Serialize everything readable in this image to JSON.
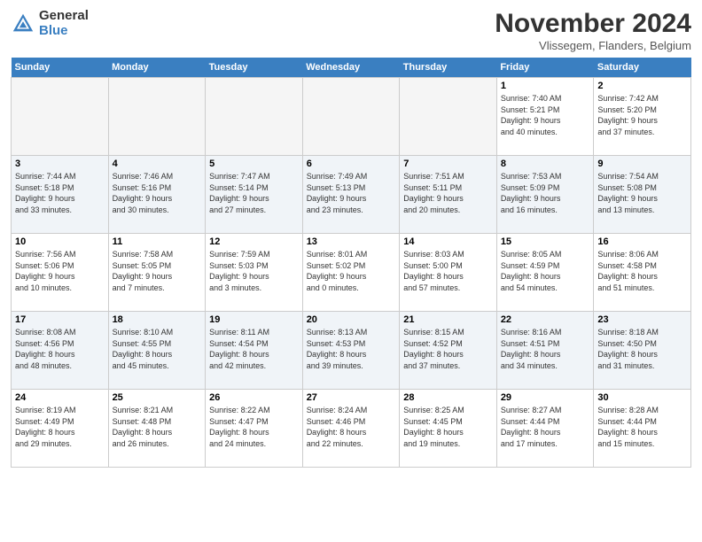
{
  "header": {
    "logo_general": "General",
    "logo_blue": "Blue",
    "month_title": "November 2024",
    "subtitle": "Vlissegem, Flanders, Belgium"
  },
  "weekdays": [
    "Sunday",
    "Monday",
    "Tuesday",
    "Wednesday",
    "Thursday",
    "Friday",
    "Saturday"
  ],
  "weeks": [
    [
      {
        "day": "",
        "info": ""
      },
      {
        "day": "",
        "info": ""
      },
      {
        "day": "",
        "info": ""
      },
      {
        "day": "",
        "info": ""
      },
      {
        "day": "",
        "info": ""
      },
      {
        "day": "1",
        "info": "Sunrise: 7:40 AM\nSunset: 5:21 PM\nDaylight: 9 hours\nand 40 minutes."
      },
      {
        "day": "2",
        "info": "Sunrise: 7:42 AM\nSunset: 5:20 PM\nDaylight: 9 hours\nand 37 minutes."
      }
    ],
    [
      {
        "day": "3",
        "info": "Sunrise: 7:44 AM\nSunset: 5:18 PM\nDaylight: 9 hours\nand 33 minutes."
      },
      {
        "day": "4",
        "info": "Sunrise: 7:46 AM\nSunset: 5:16 PM\nDaylight: 9 hours\nand 30 minutes."
      },
      {
        "day": "5",
        "info": "Sunrise: 7:47 AM\nSunset: 5:14 PM\nDaylight: 9 hours\nand 27 minutes."
      },
      {
        "day": "6",
        "info": "Sunrise: 7:49 AM\nSunset: 5:13 PM\nDaylight: 9 hours\nand 23 minutes."
      },
      {
        "day": "7",
        "info": "Sunrise: 7:51 AM\nSunset: 5:11 PM\nDaylight: 9 hours\nand 20 minutes."
      },
      {
        "day": "8",
        "info": "Sunrise: 7:53 AM\nSunset: 5:09 PM\nDaylight: 9 hours\nand 16 minutes."
      },
      {
        "day": "9",
        "info": "Sunrise: 7:54 AM\nSunset: 5:08 PM\nDaylight: 9 hours\nand 13 minutes."
      }
    ],
    [
      {
        "day": "10",
        "info": "Sunrise: 7:56 AM\nSunset: 5:06 PM\nDaylight: 9 hours\nand 10 minutes."
      },
      {
        "day": "11",
        "info": "Sunrise: 7:58 AM\nSunset: 5:05 PM\nDaylight: 9 hours\nand 7 minutes."
      },
      {
        "day": "12",
        "info": "Sunrise: 7:59 AM\nSunset: 5:03 PM\nDaylight: 9 hours\nand 3 minutes."
      },
      {
        "day": "13",
        "info": "Sunrise: 8:01 AM\nSunset: 5:02 PM\nDaylight: 9 hours\nand 0 minutes."
      },
      {
        "day": "14",
        "info": "Sunrise: 8:03 AM\nSunset: 5:00 PM\nDaylight: 8 hours\nand 57 minutes."
      },
      {
        "day": "15",
        "info": "Sunrise: 8:05 AM\nSunset: 4:59 PM\nDaylight: 8 hours\nand 54 minutes."
      },
      {
        "day": "16",
        "info": "Sunrise: 8:06 AM\nSunset: 4:58 PM\nDaylight: 8 hours\nand 51 minutes."
      }
    ],
    [
      {
        "day": "17",
        "info": "Sunrise: 8:08 AM\nSunset: 4:56 PM\nDaylight: 8 hours\nand 48 minutes."
      },
      {
        "day": "18",
        "info": "Sunrise: 8:10 AM\nSunset: 4:55 PM\nDaylight: 8 hours\nand 45 minutes."
      },
      {
        "day": "19",
        "info": "Sunrise: 8:11 AM\nSunset: 4:54 PM\nDaylight: 8 hours\nand 42 minutes."
      },
      {
        "day": "20",
        "info": "Sunrise: 8:13 AM\nSunset: 4:53 PM\nDaylight: 8 hours\nand 39 minutes."
      },
      {
        "day": "21",
        "info": "Sunrise: 8:15 AM\nSunset: 4:52 PM\nDaylight: 8 hours\nand 37 minutes."
      },
      {
        "day": "22",
        "info": "Sunrise: 8:16 AM\nSunset: 4:51 PM\nDaylight: 8 hours\nand 34 minutes."
      },
      {
        "day": "23",
        "info": "Sunrise: 8:18 AM\nSunset: 4:50 PM\nDaylight: 8 hours\nand 31 minutes."
      }
    ],
    [
      {
        "day": "24",
        "info": "Sunrise: 8:19 AM\nSunset: 4:49 PM\nDaylight: 8 hours\nand 29 minutes."
      },
      {
        "day": "25",
        "info": "Sunrise: 8:21 AM\nSunset: 4:48 PM\nDaylight: 8 hours\nand 26 minutes."
      },
      {
        "day": "26",
        "info": "Sunrise: 8:22 AM\nSunset: 4:47 PM\nDaylight: 8 hours\nand 24 minutes."
      },
      {
        "day": "27",
        "info": "Sunrise: 8:24 AM\nSunset: 4:46 PM\nDaylight: 8 hours\nand 22 minutes."
      },
      {
        "day": "28",
        "info": "Sunrise: 8:25 AM\nSunset: 4:45 PM\nDaylight: 8 hours\nand 19 minutes."
      },
      {
        "day": "29",
        "info": "Sunrise: 8:27 AM\nSunset: 4:44 PM\nDaylight: 8 hours\nand 17 minutes."
      },
      {
        "day": "30",
        "info": "Sunrise: 8:28 AM\nSunset: 4:44 PM\nDaylight: 8 hours\nand 15 minutes."
      }
    ]
  ]
}
